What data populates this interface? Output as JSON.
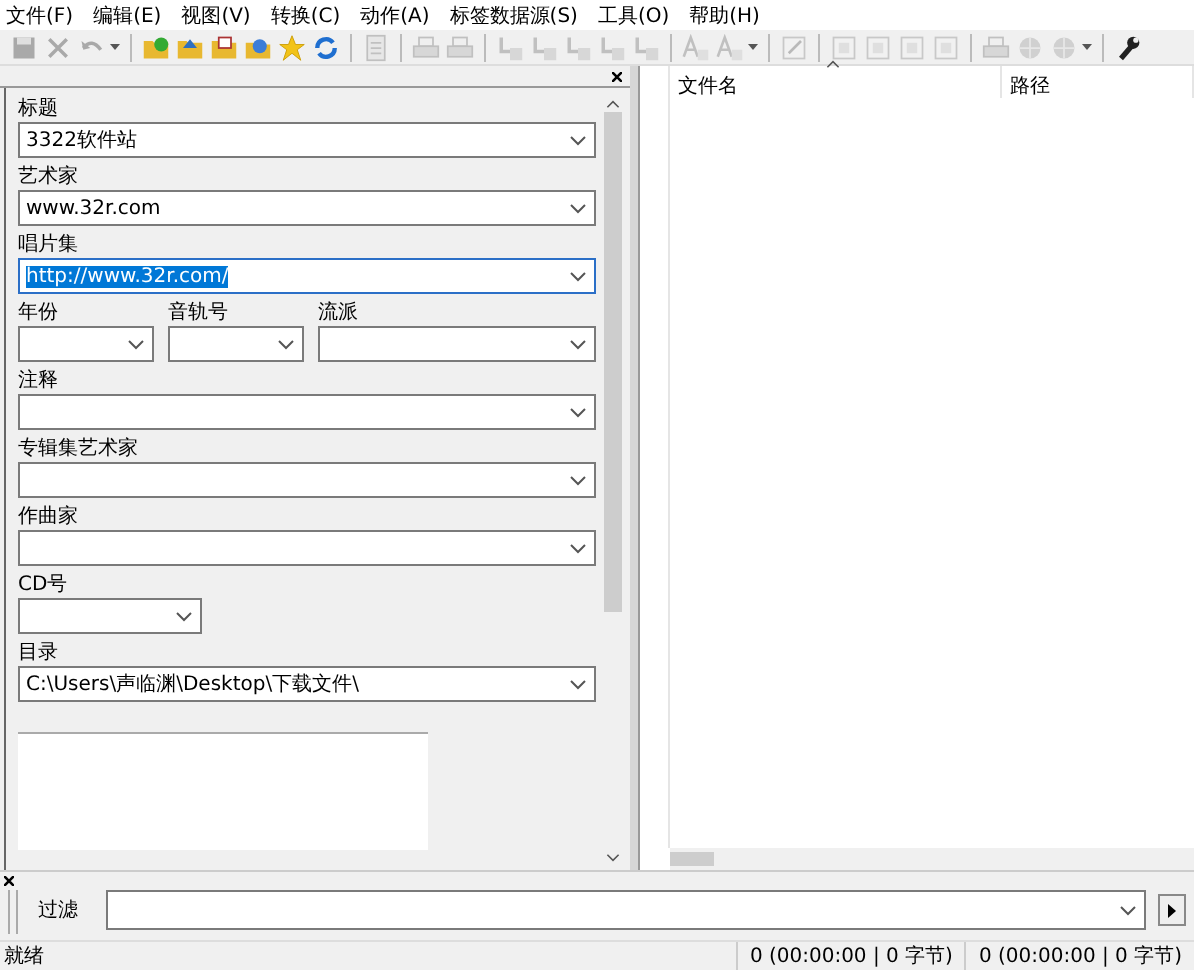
{
  "menu": [
    "文件(F)",
    "编辑(E)",
    "视图(V)",
    "转换(C)",
    "动作(A)",
    "标签数据源(S)",
    "工具(O)",
    "帮助(H)"
  ],
  "toolbar": [
    {
      "kind": "save",
      "disabled": true
    },
    {
      "kind": "delete",
      "disabled": true
    },
    {
      "kind": "undo",
      "disabled": true,
      "dropdown": true
    },
    {
      "kind": "sep"
    },
    {
      "kind": "folder-check",
      "disabled": false
    },
    {
      "kind": "folder-up",
      "disabled": false
    },
    {
      "kind": "folder-list",
      "disabled": false
    },
    {
      "kind": "folder-globe",
      "disabled": false
    },
    {
      "kind": "star",
      "disabled": false
    },
    {
      "kind": "refresh",
      "disabled": false
    },
    {
      "kind": "sep"
    },
    {
      "kind": "document",
      "disabled": true
    },
    {
      "kind": "sep"
    },
    {
      "kind": "printer",
      "disabled": true
    },
    {
      "kind": "printer",
      "disabled": true
    },
    {
      "kind": "sep"
    },
    {
      "kind": "convert",
      "disabled": true
    },
    {
      "kind": "convert",
      "disabled": true
    },
    {
      "kind": "convert",
      "disabled": true
    },
    {
      "kind": "convert",
      "disabled": true
    },
    {
      "kind": "convert",
      "disabled": true
    },
    {
      "kind": "sep"
    },
    {
      "kind": "letters",
      "disabled": true
    },
    {
      "kind": "letters",
      "disabled": true,
      "dropdown": true
    },
    {
      "kind": "sep"
    },
    {
      "kind": "edit",
      "disabled": true
    },
    {
      "kind": "sep"
    },
    {
      "kind": "export",
      "disabled": true
    },
    {
      "kind": "export",
      "disabled": true
    },
    {
      "kind": "export",
      "disabled": true
    },
    {
      "kind": "export",
      "disabled": true
    },
    {
      "kind": "sep"
    },
    {
      "kind": "printer",
      "disabled": true
    },
    {
      "kind": "globe",
      "disabled": true
    },
    {
      "kind": "globe",
      "disabled": true,
      "dropdown": true
    },
    {
      "kind": "sep"
    },
    {
      "kind": "wrench",
      "disabled": false
    }
  ],
  "tag_panel": {
    "rows": [
      [
        {
          "kind": "wide",
          "label": "标题",
          "value": "3322软件站",
          "text_selected": false
        }
      ],
      [
        {
          "kind": "wide",
          "label": "艺术家",
          "value": "www.32r.com",
          "text_selected": false
        }
      ],
      [
        {
          "kind": "wide",
          "label": "唱片集",
          "value": "http://www.32r.com/",
          "text_selected": true
        }
      ],
      [
        {
          "kind": "short",
          "label": "年份"
        },
        {
          "kind": "short",
          "label": "音轨号"
        },
        {
          "kind": "wide",
          "label": "流派"
        }
      ],
      [
        {
          "kind": "wide",
          "label": "注释"
        }
      ],
      [
        {
          "kind": "wide",
          "label": "专辑集艺术家"
        }
      ],
      [
        {
          "kind": "wide",
          "label": "作曲家"
        }
      ],
      [
        {
          "kind": "short",
          "label": "CD号"
        }
      ],
      [
        {
          "kind": "wide",
          "label": "目录",
          "value": "C:\\Users\\声临渊\\Desktop\\下载文件\\",
          "text_selected": false
        }
      ]
    ]
  },
  "file_list": {
    "columns": [
      "文件名",
      "路径"
    ]
  },
  "filter": {
    "label": "过滤"
  },
  "status_bar": {
    "text": "就绪",
    "selected_info": "0 (00:00:00 | 0 字节)",
    "total_info": "0 (00:00:00 | 0 字节)"
  }
}
